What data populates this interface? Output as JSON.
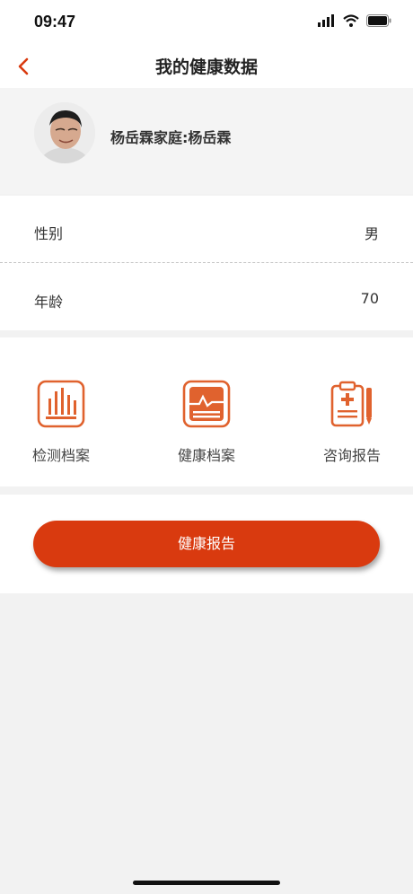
{
  "status": {
    "time": "09:47"
  },
  "nav": {
    "title": "我的健康数据"
  },
  "profile": {
    "name": "杨岳霖家庭:杨岳霖"
  },
  "info": {
    "gender_label": "性别",
    "gender_value": "男",
    "age_label": "年龄",
    "age_value": "70"
  },
  "grid": [
    {
      "label": "检测档案",
      "icon": "bar-chart-icon"
    },
    {
      "label": "健康档案",
      "icon": "health-chart-icon"
    },
    {
      "label": "咨询报告",
      "icon": "medical-clipboard-icon"
    }
  ],
  "report_button": {
    "label": "健康报告"
  },
  "colors": {
    "accent": "#d93a0f",
    "icon_orange": "#e0622e"
  }
}
